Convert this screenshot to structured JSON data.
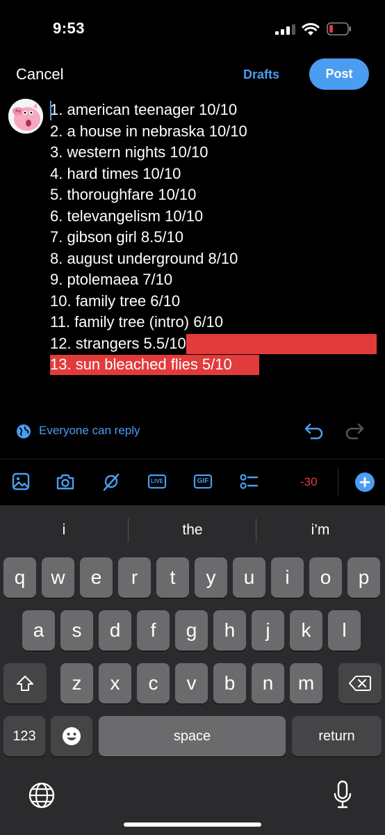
{
  "status_bar": {
    "time": "9:53"
  },
  "top_bar": {
    "cancel": "Cancel",
    "drafts": "Drafts",
    "post": "Post"
  },
  "compose": {
    "lines": [
      "1. american teenager 10/10",
      "2. a house in nebraska 10/10",
      "3. western nights 10/10",
      "4. hard times 10/10",
      "5. thoroughfare 10/10",
      "6. televangelism 10/10",
      "7. gibson girl 8.5/10",
      "8. august underground 8/10",
      "9. ptolemaea 7/10",
      "10. family tree 6/10",
      "11. family tree (intro) 6/10",
      "12. strangers 5.5/10",
      "13. sun bleached flies 5/10"
    ]
  },
  "reply_setting": {
    "label": "Everyone can reply"
  },
  "toolbar": {
    "icons": [
      "image-icon",
      "camera-icon",
      "search-icon",
      "live-icon",
      "gif-icon",
      "poll-icon"
    ],
    "live_label": "LIVE",
    "gif_label": "GIF",
    "char_remaining": "-30"
  },
  "keyboard": {
    "suggestions": [
      "i",
      "the",
      "i’m"
    ],
    "row1": [
      "q",
      "w",
      "e",
      "r",
      "t",
      "y",
      "u",
      "i",
      "o",
      "p"
    ],
    "row2": [
      "a",
      "s",
      "d",
      "f",
      "g",
      "h",
      "j",
      "k",
      "l"
    ],
    "row3": [
      "z",
      "x",
      "c",
      "v",
      "b",
      "n",
      "m"
    ],
    "numbers_key": "123",
    "space_key": "space",
    "return_key": "return"
  },
  "colors": {
    "accent": "#4a9df0",
    "over_limit": "#e23b3b",
    "keyboard_bg": "#2b2b2d"
  }
}
